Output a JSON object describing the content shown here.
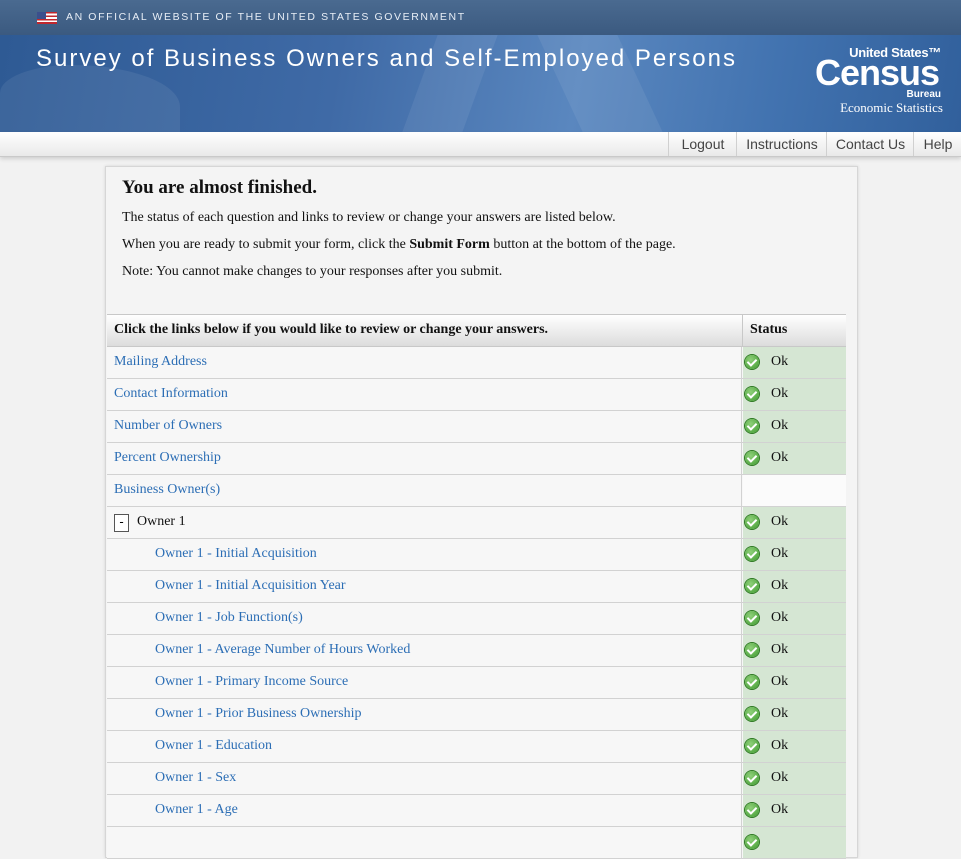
{
  "gov_banner": {
    "text": "AN OFFICIAL WEBSITE OF THE UNITED STATES GOVERNMENT"
  },
  "header": {
    "title": "Survey of Business Owners and Self-Employed Persons",
    "logo": {
      "united_states": "United States™",
      "census": "Census",
      "bureau": "Bureau",
      "subtitle": "Economic Statistics"
    }
  },
  "nav": {
    "items": [
      "Logout",
      "Instructions",
      "Contact Us",
      "Help"
    ]
  },
  "main": {
    "heading": "You are almost finished.",
    "para1": "The status of each question and links to review or change your answers are listed below.",
    "para2_before": "When you are ready to submit your form, click the ",
    "para2_bold": "Submit Form",
    "para2_after": " button at the bottom of the page.",
    "para3": "Note: You cannot make changes to your responses after you submit."
  },
  "table": {
    "header_left": "Click the links below if you would like to review or change your answers.",
    "header_right": "Status",
    "rows": [
      {
        "label": "Mailing Address",
        "status": "Ok"
      },
      {
        "label": "Contact Information",
        "status": "Ok"
      },
      {
        "label": "Number of Owners",
        "status": "Ok"
      },
      {
        "label": "Percent Ownership",
        "status": "Ok"
      },
      {
        "label": "Business Owner(s)",
        "status": ""
      },
      {
        "label": "Owner 1",
        "status": "Ok",
        "toggle": "-"
      },
      {
        "label": "Owner 1 - Initial Acquisition",
        "status": "Ok"
      },
      {
        "label": "Owner 1 - Initial Acquisition Year",
        "status": "Ok"
      },
      {
        "label": "Owner 1 - Job Function(s)",
        "status": "Ok"
      },
      {
        "label": "Owner 1 - Average Number of Hours Worked",
        "status": "Ok"
      },
      {
        "label": "Owner 1 - Primary Income Source",
        "status": "Ok"
      },
      {
        "label": "Owner 1 - Prior Business Ownership",
        "status": "Ok"
      },
      {
        "label": "Owner 1 - Education",
        "status": "Ok"
      },
      {
        "label": "Owner 1 - Sex",
        "status": "Ok"
      },
      {
        "label": "Owner 1 - Age",
        "status": "Ok"
      },
      {
        "label": "",
        "status": ""
      }
    ]
  }
}
